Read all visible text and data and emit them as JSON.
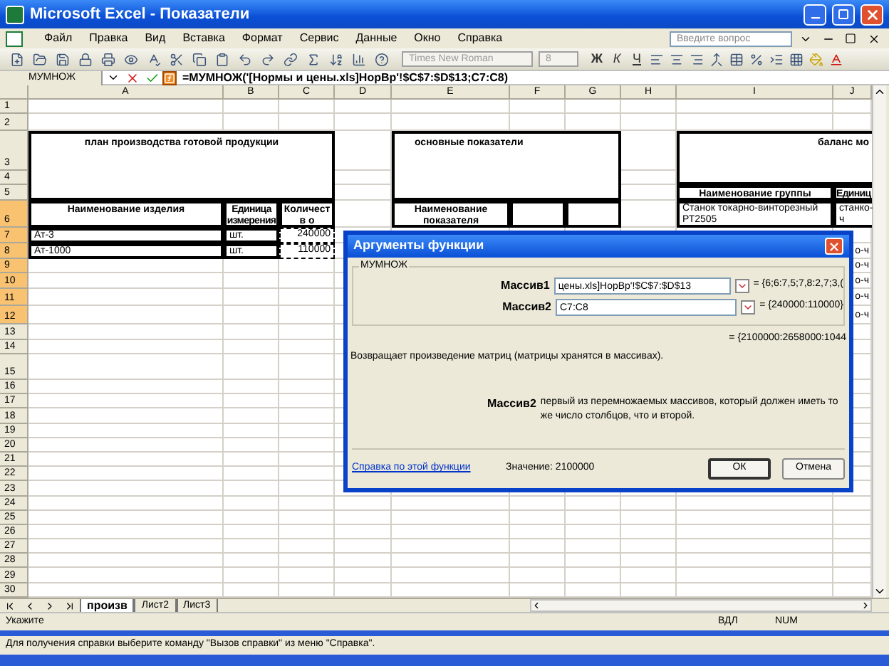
{
  "window": {
    "title": "Microsoft Excel - Показатели"
  },
  "menu": [
    "Файл",
    "Правка",
    "Вид",
    "Вставка",
    "Формат",
    "Сервис",
    "Данные",
    "Окно",
    "Справка"
  ],
  "help_search": {
    "placeholder": "Введите вопрос"
  },
  "toolbar": {
    "font": "Times New Roman",
    "size": "8",
    "disabled": true,
    "format_buttons": [
      "Ж",
      "К",
      "Ч"
    ]
  },
  "formula_bar": {
    "name_box": "МУМНОЖ",
    "formula": "=МУМНОЖ('[Нормы и цены.xls]НорВр'!$C$7:$D$13;C7:C8)"
  },
  "columns": [
    "A",
    "B",
    "C",
    "D",
    "E",
    "F",
    "G",
    "H",
    "I",
    "J"
  ],
  "rows": [
    {
      "label": "1",
      "selected": false
    },
    {
      "label": "2",
      "selected": false
    },
    {
      "label": "3",
      "selected": false
    },
    {
      "label": "4",
      "selected": false
    },
    {
      "label": "5",
      "selected": false
    },
    {
      "label": "6",
      "selected": true
    },
    {
      "label": "7",
      "selected": true
    },
    {
      "label": "8",
      "selected": true
    },
    {
      "label": "9",
      "selected": true
    },
    {
      "label": "10",
      "selected": true
    },
    {
      "label": "11",
      "selected": true
    },
    {
      "label": "12",
      "selected": true
    },
    {
      "label": "13",
      "selected": false
    },
    {
      "label": "14",
      "selected": false
    },
    {
      "label": "15",
      "selected": false
    },
    {
      "label": "16",
      "selected": false
    },
    {
      "label": "17",
      "selected": false
    },
    {
      "label": "18",
      "selected": false
    },
    {
      "label": "19",
      "selected": false
    },
    {
      "label": "20",
      "selected": false
    },
    {
      "label": "21",
      "selected": false
    },
    {
      "label": "22",
      "selected": false
    },
    {
      "label": "23",
      "selected": false
    },
    {
      "label": "24",
      "selected": false
    },
    {
      "label": "25",
      "selected": false
    },
    {
      "label": "26",
      "selected": false
    },
    {
      "label": "27",
      "selected": false
    },
    {
      "label": "28",
      "selected": false
    },
    {
      "label": "29",
      "selected": false
    },
    {
      "label": "30",
      "selected": false
    }
  ],
  "production_table": {
    "title": "план производства готовой продукции",
    "headers": [
      "Наименование изделия",
      "Единица измерения",
      "Количеств о"
    ],
    "rows": [
      {
        "name": "Ат-3",
        "unit": "шт.",
        "quantity": "240000",
        "referenced": true
      },
      {
        "name": "Ат-1000",
        "unit": "шт.",
        "quantity": "110000",
        "referenced": true
      }
    ]
  },
  "indicators_table": {
    "title": "основные показатели",
    "header": "Наименование показателя"
  },
  "balance_table": {
    "title": "баланс мо",
    "headers": [
      "Наименование группы",
      "Единиц"
    ],
    "row": [
      "Станок токарно-винторезный РТ2505",
      "станко-ч"
    ],
    "column_j_fragments": [
      "о-ч",
      "о-ч",
      "о-ч",
      "о-ч",
      "о-ч"
    ]
  },
  "sheet_tabs": [
    {
      "label": "произв",
      "selected": true
    },
    {
      "label": "Лист2",
      "selected": false
    },
    {
      "label": "Лист3",
      "selected": false
    }
  ],
  "status_bar": {
    "mode": "Укажите",
    "indicators": [
      "ВДЛ",
      "NUM"
    ]
  },
  "dialog": {
    "title": "Аргументы функции",
    "group": "МУМНОЖ",
    "arguments": [
      {
        "label": "Массив1",
        "value": "цены.xls]НорВр'!$C$7:$D$13",
        "result": "= {6;6:7,5;7,8:2,7;3,("
      },
      {
        "label": "Массив2",
        "value": "C7:C8",
        "result": "= {240000:110000}"
      }
    ],
    "formula_result": "= {2100000:2658000:1044",
    "description": "Возвращает произведение матриц (матрицы хранятся в массивах).",
    "argument_help": {
      "label": "Массив2",
      "text": "первый из перемножаемых массивов, который должен иметь то же число столбцов, что и второй."
    },
    "help_link": "Справка по этой функции",
    "value": "Значение: 2100000",
    "buttons": [
      {
        "label": "ОК",
        "default": true
      },
      {
        "label": "Отмена",
        "default": false
      }
    ]
  },
  "app_status": "Для получения справки выберите команду \"Вызов справки\" из меню \"Справка\"."
}
